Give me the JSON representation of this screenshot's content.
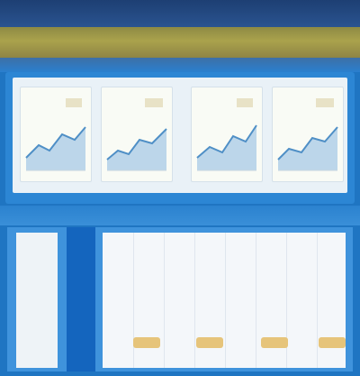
{
  "header": {
    "title": ""
  },
  "banner": {
    "text": ""
  },
  "cards": [
    {
      "label": ""
    },
    {
      "label": ""
    },
    {
      "label": ""
    },
    {
      "label": ""
    }
  ],
  "table": {
    "columns": [
      "",
      "",
      "",
      "",
      "",
      "",
      "",
      ""
    ],
    "highlighted_cells": 4
  },
  "colors": {
    "header_bg": "#1d3f73",
    "banner_bg": "#aaa24c",
    "page_bg": "#1f75c2",
    "accent_column": "#1465be",
    "highlight": "#e6c47a"
  },
  "icons": [
    "chart-icon",
    "chart-icon",
    "chart-icon",
    "chart-icon"
  ]
}
